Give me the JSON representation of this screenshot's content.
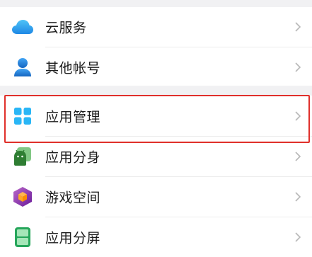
{
  "settings_list": {
    "group_1": [
      {
        "label": "云服务",
        "icon": "cloud-icon"
      },
      {
        "label": "其他帐号",
        "icon": "person-icon"
      }
    ],
    "group_2": [
      {
        "label": "应用管理",
        "icon": "app-grid-icon"
      },
      {
        "label": "应用分身",
        "icon": "android-clone-icon"
      },
      {
        "label": "游戏空间",
        "icon": "game-cube-icon"
      },
      {
        "label": "应用分屏",
        "icon": "split-screen-icon"
      }
    ]
  },
  "highlight": {
    "target": "应用管理",
    "color": "#e0302b"
  },
  "colors": {
    "background": "#f1f1f3",
    "row": "#ffffff",
    "text": "#1c1c1c",
    "chevron": "#b8b8b8"
  }
}
